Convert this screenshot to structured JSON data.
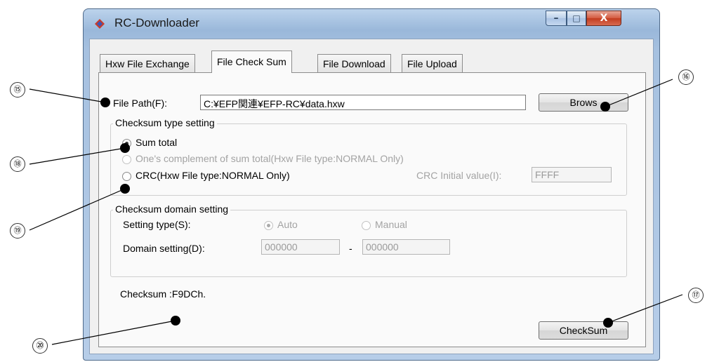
{
  "window": {
    "title": "RC-Downloader",
    "controls": {
      "minimize": "–",
      "maximize": "□",
      "close": "X"
    }
  },
  "tabs": [
    {
      "label": "Hxw File Exchange"
    },
    {
      "label": "File Check Sum"
    },
    {
      "label": "File Download"
    },
    {
      "label": "File Upload"
    }
  ],
  "file_path": {
    "label": "File Path(F):",
    "value": "C:¥EFP関連¥EFP-RC¥data.hxw",
    "browse_label": "Brows"
  },
  "checksum_type": {
    "title": "Checksum type setting",
    "options": [
      {
        "label": "Sum total"
      },
      {
        "label": "One's complement of sum total(Hxw File type:NORMAL Only)"
      },
      {
        "label": "CRC(Hxw File type:NORMAL Only)"
      }
    ],
    "crc_label": "CRC Initial value(I):",
    "crc_value": "FFFF"
  },
  "checksum_domain": {
    "title": "Checksum domain setting",
    "setting_type_label": "Setting type(S):",
    "auto_label": "Auto",
    "manual_label": "Manual",
    "domain_label": "Domain setting(D):",
    "domain_from": "000000",
    "domain_sep": "-",
    "domain_to": "000000"
  },
  "result": {
    "text": "Checksum :F9DCh."
  },
  "checksum_button": "CheckSum",
  "callouts": {
    "c15": "⑮",
    "c16": "⑯",
    "c17": "⑰",
    "c18": "⑱",
    "c19": "⑲",
    "c20": "⑳"
  }
}
